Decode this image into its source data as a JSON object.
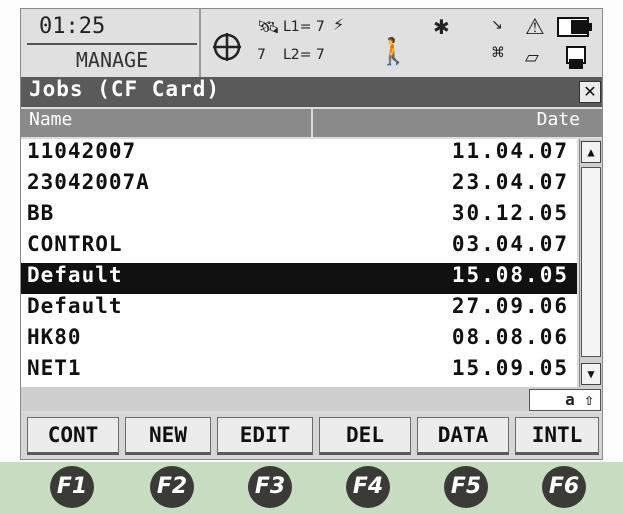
{
  "status": {
    "time": "01:25",
    "mode": "MANAGE",
    "satellites_tracked": "7",
    "l1": "L1= 7",
    "l2": "L2= 7",
    "input_mode": "a ⇧"
  },
  "window": {
    "title": "Jobs (CF Card)",
    "close_label": "✕"
  },
  "columns": {
    "name": "Name",
    "date": "Date"
  },
  "jobs": [
    {
      "name": "11042007",
      "date": "11.04.07"
    },
    {
      "name": "23042007A",
      "date": "23.04.07"
    },
    {
      "name": "BB",
      "date": "30.12.05"
    },
    {
      "name": "CONTROL",
      "date": "03.04.07"
    },
    {
      "name": "Default",
      "date": "15.08.05",
      "selected": true
    },
    {
      "name": "Default",
      "date": "27.09.06"
    },
    {
      "name": "HK80",
      "date": "08.08.06"
    },
    {
      "name": "NET1",
      "date": "15.09.05"
    }
  ],
  "softkeys": [
    "CONT",
    "NEW",
    "EDIT",
    "DEL",
    "DATA",
    "INTL"
  ],
  "function_keys": [
    "F1",
    "F2",
    "F3",
    "F4",
    "F5",
    "F6"
  ],
  "icons": {
    "crosshair": "crosshair-icon",
    "satellite": "satellite-icon",
    "signal": "signal-icon",
    "rover": "rover-icon",
    "bluetooth": "bluetooth-icon",
    "link": "link-icon",
    "network": "network-icon",
    "antenna": "antenna-icon",
    "memory_card": "memory-card-icon",
    "battery": "battery-icon",
    "sd_card": "sd-card-icon"
  },
  "colors": {
    "title_bar": "#5a5a5a",
    "selection": "#111111",
    "function_key_strip": "#c7dcc0"
  }
}
